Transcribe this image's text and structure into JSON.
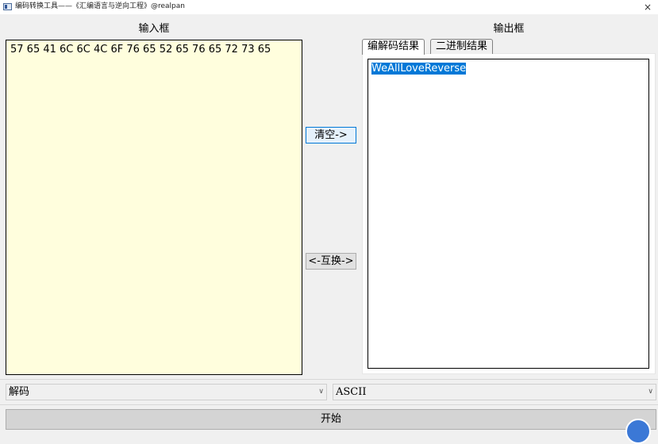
{
  "window": {
    "title": "编码转换工具——《汇编语言与逆向工程》@realpan",
    "close_glyph": "×"
  },
  "input": {
    "label": "输入框",
    "value": "57 65 41 6C 6C 4C 6F 76 65 52 65 76 65 72 73 65"
  },
  "middle": {
    "clear_label": "清空->",
    "swap_label": "<-互换->"
  },
  "output": {
    "label": "输出框",
    "tabs": [
      {
        "label": "编解码结果",
        "selected": true
      },
      {
        "label": "二进制结果",
        "selected": false
      }
    ],
    "value": "WeAllLoveReverse"
  },
  "controls": {
    "mode_value": "解码",
    "encoding_value": "ASCII",
    "start_label": "开始"
  },
  "colors": {
    "input_bg": "#fffedd",
    "selection": "#0078d7"
  },
  "icons": {
    "app": "app-window-icon",
    "close": "close-icon",
    "dropdown": "chevron-down-icon"
  }
}
